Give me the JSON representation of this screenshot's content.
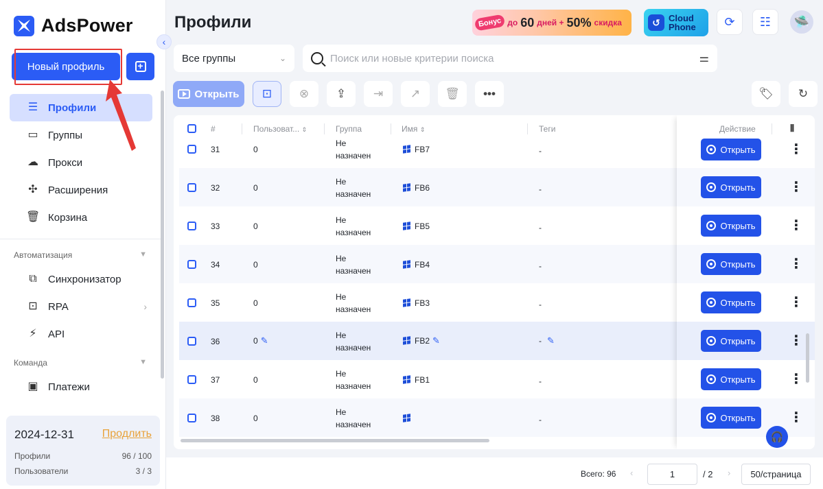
{
  "app": {
    "name": "AdsPower"
  },
  "sidebar": {
    "new_profile_label": "Новый профиль",
    "nav": [
      {
        "label": "Профили",
        "icon": "profiles-icon"
      },
      {
        "label": "Группы",
        "icon": "folder-icon"
      },
      {
        "label": "Прокси",
        "icon": "proxy-icon"
      },
      {
        "label": "Расширения",
        "icon": "puzzle-icon"
      },
      {
        "label": "Корзина",
        "icon": "trash-icon"
      }
    ],
    "automation_label": "Автоматизация",
    "automation": [
      {
        "label": "Синхронизатор",
        "icon": "sync-icon"
      },
      {
        "label": "RPA",
        "icon": "robot-icon"
      },
      {
        "label": "API",
        "icon": "plug-icon"
      }
    ],
    "team_label": "Команда",
    "team": [
      {
        "label": "Платежи",
        "icon": "wallet-icon"
      }
    ],
    "plan": {
      "date": "2024-12-31",
      "renew_label": "Продлить",
      "profiles_label": "Профили",
      "profiles_value": "96 / 100",
      "users_label": "Пользователи",
      "users_value": "3 / 3"
    }
  },
  "header": {
    "title": "Профили",
    "promo": {
      "badge": "Бонус",
      "text1": "до",
      "num1": "60",
      "text2": "дней +",
      "num2": "50%",
      "text3": "скидка"
    },
    "cloud_phone": {
      "line1": "Cloud",
      "line2": "Phone"
    }
  },
  "filters": {
    "group_select": "Все группы",
    "search_placeholder": "Поиск или новые критерии поиска"
  },
  "toolbar": {
    "open_label": "Открыть"
  },
  "table": {
    "columns": {
      "num": "#",
      "user": "Пользоват...",
      "group": "Группа",
      "name": "Имя",
      "tags": "Теги",
      "action": "Действие"
    },
    "rows": [
      {
        "num": "31",
        "user": "0",
        "group1": "Не",
        "group2": "назначен",
        "name": "FB7",
        "tags": "-",
        "action": "Открыть"
      },
      {
        "num": "32",
        "user": "0",
        "group1": "Не",
        "group2": "назначен",
        "name": "FB6",
        "tags": "-",
        "action": "Открыть"
      },
      {
        "num": "33",
        "user": "0",
        "group1": "Не",
        "group2": "назначен",
        "name": "FB5",
        "tags": "-",
        "action": "Открыть"
      },
      {
        "num": "34",
        "user": "0",
        "group1": "Не",
        "group2": "назначен",
        "name": "FB4",
        "tags": "-",
        "action": "Открыть"
      },
      {
        "num": "35",
        "user": "0",
        "group1": "Не",
        "group2": "назначен",
        "name": "FB3",
        "tags": "-",
        "action": "Открыть"
      },
      {
        "num": "36",
        "user": "0",
        "group1": "Не",
        "group2": "назначен",
        "name": "FB2",
        "tags": "-",
        "action": "Открыть"
      },
      {
        "num": "37",
        "user": "0",
        "group1": "Не",
        "group2": "назначен",
        "name": "FB1",
        "tags": "-",
        "action": "Открыть"
      },
      {
        "num": "38",
        "user": "0",
        "group1": "Не",
        "group2": "назначен",
        "name": "",
        "tags": "-",
        "action": "Открыть"
      }
    ]
  },
  "pagination": {
    "total": "Всего: 96",
    "page": "1",
    "pages": "/ 2",
    "page_size": "50/страница"
  },
  "colors": {
    "accent": "#2b5cf5",
    "annotation": "#e53935"
  }
}
